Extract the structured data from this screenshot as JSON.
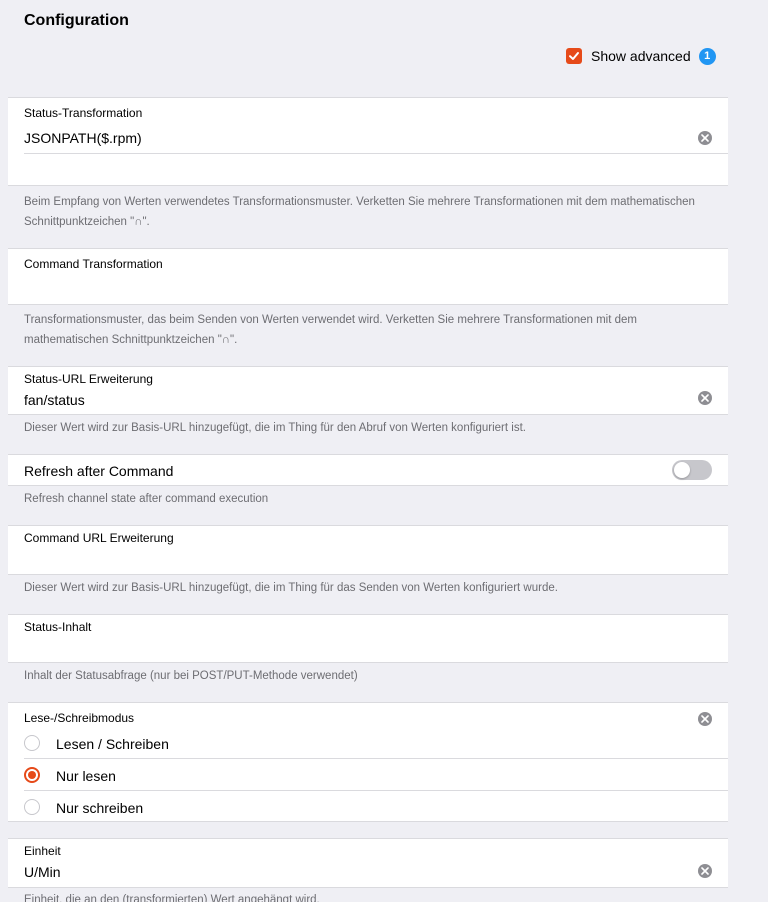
{
  "page": {
    "title": "Configuration"
  },
  "advanced": {
    "label": "Show advanced",
    "checked": true,
    "badge": "1"
  },
  "fields": {
    "status_transformation": {
      "label": "Status-Transformation",
      "value": "JSONPATH($.rpm)",
      "info": "Beim Empfang von Werten verwendetes Transformationsmuster. Verketten Sie mehrere Transformationen mit dem mathematischen Schnittpunktzeichen \"∩\"."
    },
    "command_transformation": {
      "label": "Command Transformation",
      "value": "",
      "info": "Transformationsmuster, das beim Senden von Werten verwendet wird. Verketten Sie mehrere Transformationen mit dem mathematischen Schnittpunktzeichen \"∩\"."
    },
    "status_url": {
      "label": "Status-URL Erweiterung",
      "value": "fan/status",
      "info": "Dieser Wert wird zur Basis-URL hinzugefügt, die im Thing für den Abruf von Werten konfiguriert ist."
    },
    "refresh_after_command": {
      "label": "Refresh after Command",
      "enabled": false,
      "info": "Refresh channel state after command execution"
    },
    "command_url": {
      "label": "Command URL Erweiterung",
      "value": "",
      "info": "Dieser Wert wird zur Basis-URL hinzugefügt, die im Thing für das Senden von Werten konfiguriert wurde."
    },
    "status_content": {
      "label": "Status-Inhalt",
      "value": "",
      "info": "Inhalt der Statusabfrage (nur bei POST/PUT-Methode verwendet)"
    },
    "mode": {
      "label": "Lese-/Schreibmodus",
      "options": [
        "Lesen / Schreiben",
        "Nur lesen",
        "Nur schreiben"
      ],
      "selected": "Nur lesen"
    },
    "unit": {
      "label": "Einheit",
      "value": "U/Min",
      "info": "Einheit, die an den (transformierten) Wert angehängt wird."
    }
  },
  "colors": {
    "accent": "#e64a19",
    "badge": "#2196f3",
    "background": "#efeff4"
  }
}
